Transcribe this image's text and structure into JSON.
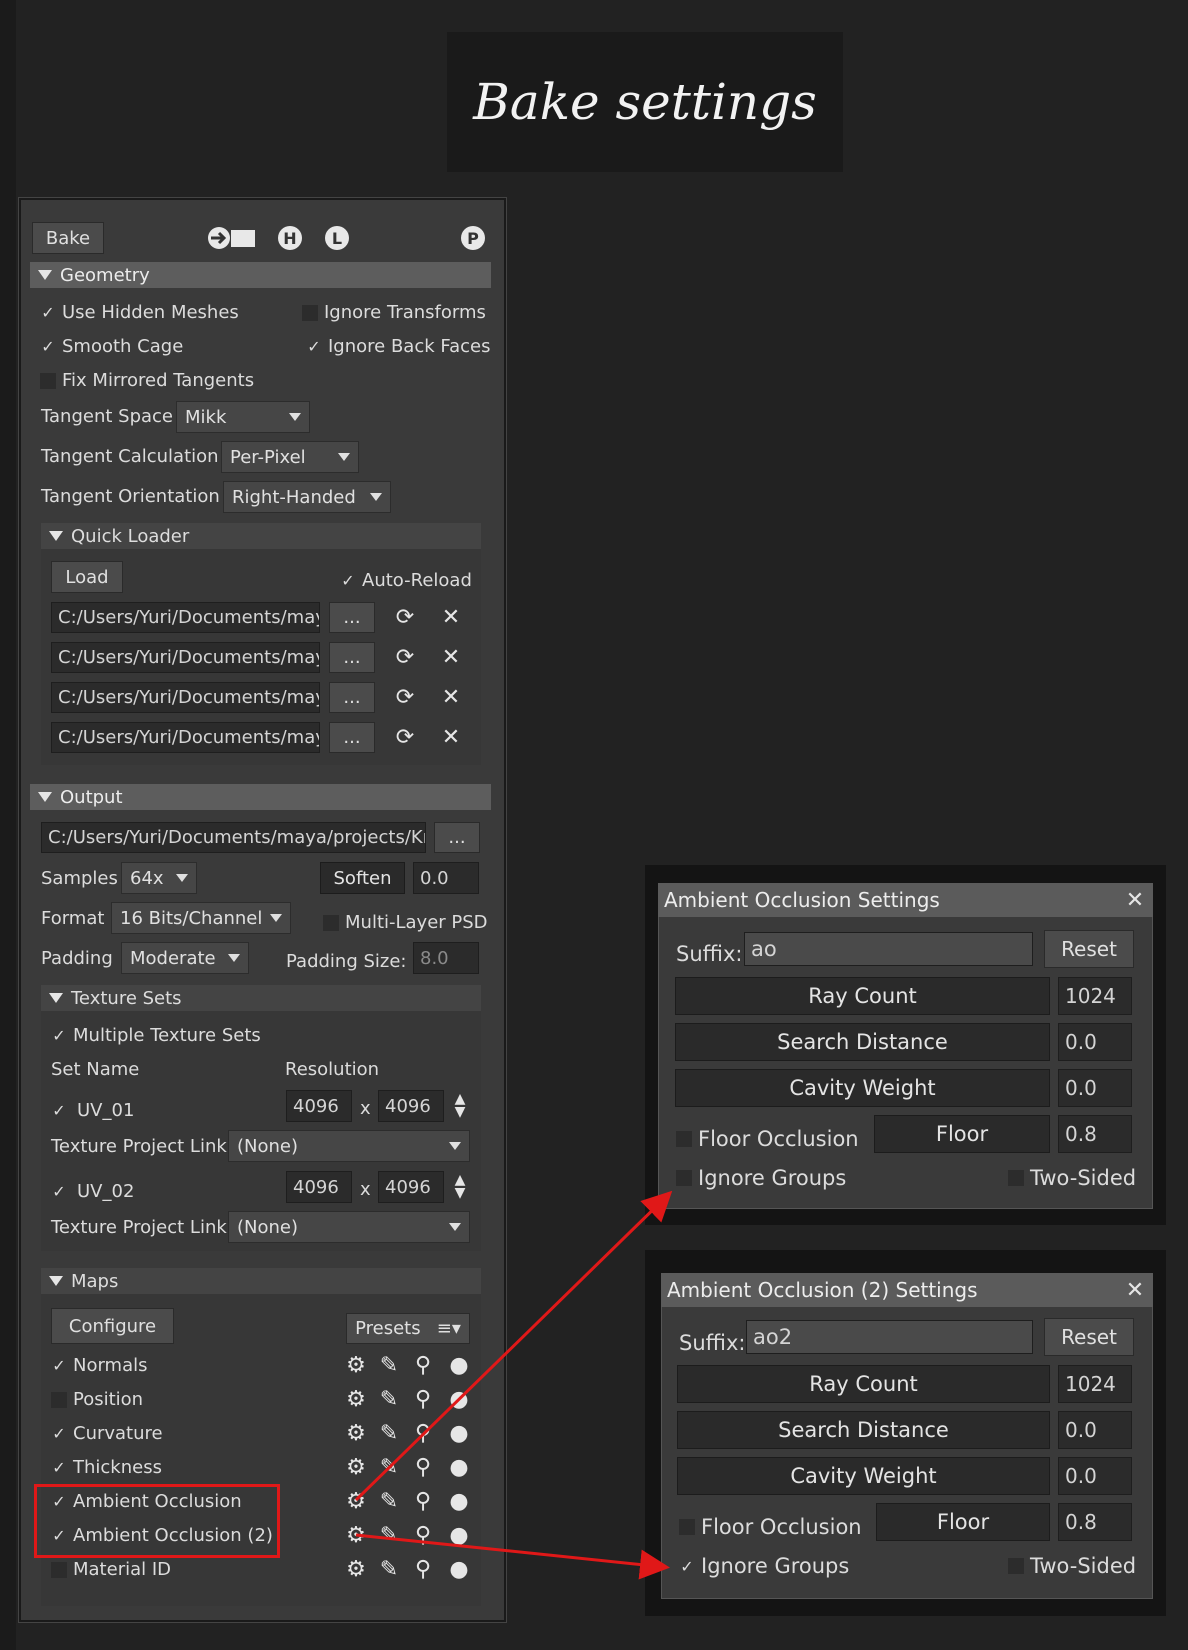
{
  "banner": {
    "title": "Bake settings"
  },
  "toolbar": {
    "bake_label": "Bake",
    "icons": [
      "export-icon",
      "high-icon",
      "low-icon",
      "preview-icon"
    ]
  },
  "geometry": {
    "header": "Geometry",
    "use_hidden": "Use Hidden Meshes",
    "ignore_transforms": "Ignore Transforms",
    "smooth_cage": "Smooth Cage",
    "ignore_back": "Ignore Back Faces",
    "fix_mirrored": "Fix Mirrored Tangents",
    "tangent_space_label": "Tangent Space",
    "tangent_space_value": "Mikk",
    "tangent_calc_label": "Tangent Calculation",
    "tangent_calc_value": "Per-Pixel",
    "tangent_orient_label": "Tangent Orientation",
    "tangent_orient_value": "Right-Handed"
  },
  "quick_loader": {
    "header": "Quick Loader",
    "load_label": "Load",
    "auto_reload": "Auto-Reload",
    "paths": [
      "C:/Users/Yuri/Documents/maya",
      "C:/Users/Yuri/Documents/maya",
      "C:/Users/Yuri/Documents/maya",
      "C:/Users/Yuri/Documents/maya"
    ],
    "browse": "..."
  },
  "output": {
    "header": "Output",
    "path": "C:/Users/Yuri/Documents/maya/projects/Kni",
    "browse": "...",
    "samples_label": "Samples",
    "samples_value": "64x",
    "soften_label": "Soften",
    "soften_value": "0.0",
    "format_label": "Format",
    "format_value": "16 Bits/Channel",
    "multilayer": "Multi-Layer PSD",
    "padding_label": "Padding",
    "padding_value": "Moderate",
    "padding_size_label": "Padding Size:",
    "padding_size_value": "8.0"
  },
  "texture_sets": {
    "header": "Texture Sets",
    "multiple": "Multiple Texture Sets",
    "col_name": "Set Name",
    "col_res": "Resolution",
    "x": "x",
    "sets": [
      {
        "name": "UV_01",
        "w": "4096",
        "h": "4096",
        "link_label": "Texture Project Link",
        "link_value": "(None)"
      },
      {
        "name": "UV_02",
        "w": "4096",
        "h": "4096",
        "link_label": "Texture Project Link",
        "link_value": "(None)"
      }
    ]
  },
  "maps": {
    "header": "Maps",
    "configure": "Configure",
    "presets": "Presets",
    "items": [
      {
        "label": "Normals",
        "checked": true
      },
      {
        "label": "Position",
        "checked": false
      },
      {
        "label": "Curvature",
        "checked": true
      },
      {
        "label": "Thickness",
        "checked": true
      },
      {
        "label": "Ambient Occlusion",
        "checked": true
      },
      {
        "label": "Ambient Occlusion (2)",
        "checked": true
      },
      {
        "label": "Material ID",
        "checked": false
      }
    ]
  },
  "dialog1": {
    "title": "Ambient Occlusion Settings",
    "close": "✕",
    "suffix_label": "Suffix:",
    "suffix": "ao",
    "reset": "Reset",
    "ray_count": "Ray Count",
    "ray_count_value": "1024",
    "search": "Search Distance",
    "search_value": "0.0",
    "cavity": "Cavity Weight",
    "cavity_value": "0.0",
    "floor_occ": "Floor Occlusion",
    "floor": "Floor",
    "floor_value": "0.8",
    "ignore_groups": "Ignore Groups",
    "two_sided": "Two-Sided"
  },
  "dialog2": {
    "title": "Ambient Occlusion (2) Settings",
    "close": "✕",
    "suffix_label": "Suffix:",
    "suffix": "ao2",
    "reset": "Reset",
    "ray_count": "Ray Count",
    "ray_count_value": "1024",
    "search": "Search Distance",
    "search_value": "0.0",
    "cavity": "Cavity Weight",
    "cavity_value": "0.0",
    "floor_occ": "Floor Occlusion",
    "floor": "Floor",
    "floor_value": "0.8",
    "ignore_groups": "Ignore Groups",
    "two_sided": "Two-Sided"
  },
  "colors": {
    "highlight": "#e01818"
  }
}
